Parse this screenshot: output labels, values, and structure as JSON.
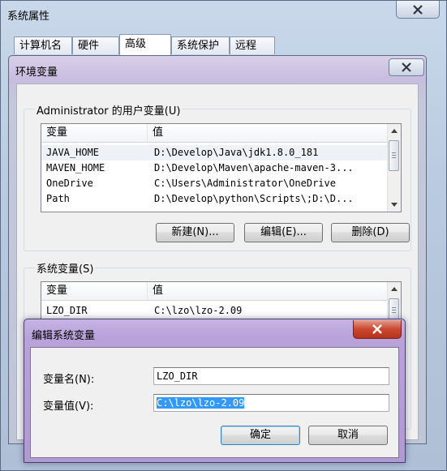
{
  "system_properties": {
    "title": "系统属性",
    "tabs": [
      {
        "label": "计算机名",
        "active": false
      },
      {
        "label": "硬件",
        "active": false
      },
      {
        "label": "高级",
        "active": true
      },
      {
        "label": "系统保护",
        "active": false
      },
      {
        "label": "远程",
        "active": false
      }
    ]
  },
  "environment_variables": {
    "title": "环境变量",
    "user_section": {
      "label": "Administrator 的用户变量(U)",
      "columns": [
        "变量",
        "值"
      ],
      "rows": [
        {
          "name": "JAVA_HOME",
          "value": "D:\\Develop\\Java\\jdk1.8.0_181"
        },
        {
          "name": "MAVEN_HOME",
          "value": "D:\\Develop\\Maven\\apache-maven-3..."
        },
        {
          "name": "OneDrive",
          "value": "C:\\Users\\Administrator\\OneDrive"
        },
        {
          "name": "Path",
          "value": "D:\\Develop\\python\\Scripts\\;D:\\D..."
        }
      ],
      "buttons": {
        "new": "新建(N)...",
        "edit": "编辑(E)...",
        "delete": "删除(D)"
      }
    },
    "system_section": {
      "label": "系统变量(S)",
      "columns": [
        "变量",
        "值"
      ],
      "rows": [
        {
          "name": "LZO_DIR",
          "value": "C:\\lzo\\lzo-2.09"
        }
      ]
    }
  },
  "edit_dialog": {
    "title": "编辑系统变量",
    "name_label": "变量名(N):",
    "name_value": "LZO_DIR",
    "value_label": "变量值(V):",
    "value_value": "C:\\lzo\\lzo-2.09",
    "ok_label": "确定",
    "cancel_label": "取消"
  },
  "colors": {
    "selection": "#3399ff",
    "edit_title_bar": "#b8a2d9",
    "close_button_red": "#c9482f"
  },
  "icons": [
    "close-icon",
    "scroll-up-arrow-icon",
    "scroll-down-arrow-icon"
  ]
}
